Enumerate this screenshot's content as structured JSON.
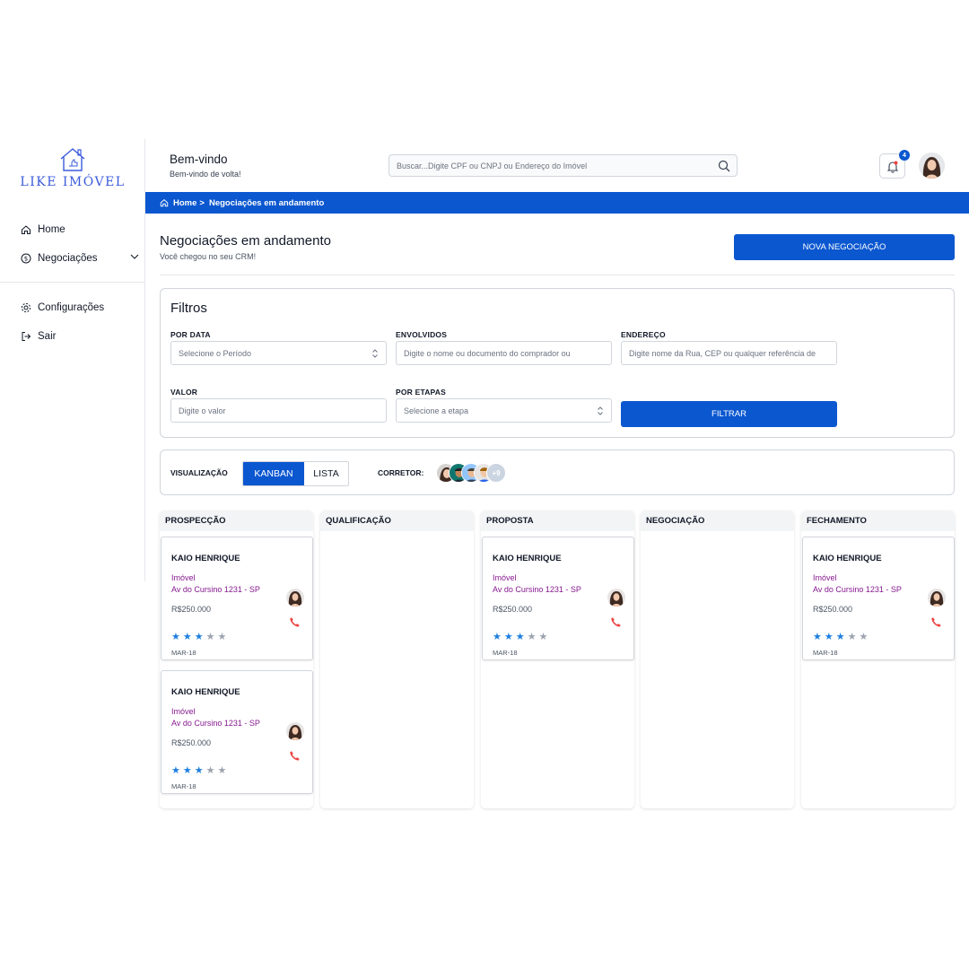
{
  "brand": {
    "logo_text": "LIKE IMÓVEL",
    "color": "#3b5bdb"
  },
  "sidebar": {
    "items": [
      {
        "label": "Home",
        "icon": "home-icon"
      },
      {
        "label": "Negociações",
        "icon": "dollar-circle-icon"
      },
      {
        "label": "Configurações",
        "icon": "gear-icon"
      },
      {
        "label": "Sair",
        "icon": "logout-icon"
      }
    ]
  },
  "header": {
    "title": "Bem-vindo",
    "subtitle": "Bem-vindo de volta!",
    "search_placeholder": "Buscar...Digite CPF ou CNPJ ou Endereço do Imóvel",
    "notifications_count": "4"
  },
  "breadcrumb": {
    "home": "Home",
    "separator": ">",
    "current": "Negociações em andamento"
  },
  "page": {
    "title": "Negociações em andamento",
    "subtitle": "Você chegou no seu CRM!",
    "new_button": "NOVA NEGOCIAÇÃO"
  },
  "filters": {
    "title": "Filtros",
    "date": {
      "label": "POR DATA",
      "placeholder": "Selecione o Período"
    },
    "involved": {
      "label": "ENVOLVIDOS",
      "placeholder": "Digite o nome ou documento do comprador ou"
    },
    "address": {
      "label": "ENDEREÇO",
      "placeholder": "Digite nome da Rua, CEP ou qualquer referência de"
    },
    "value": {
      "label": "VALOR",
      "placeholder": "Digite o valor"
    },
    "stage": {
      "label": "POR ETAPAS",
      "placeholder": "Selecione a etapa"
    },
    "submit": "FILTRAR"
  },
  "view": {
    "label": "VISUALIZAÇÃO",
    "options": [
      "KANBAN",
      "LISTA"
    ],
    "selected": "KANBAN",
    "broker_label": "CORRETOR:",
    "brokers_more": "+9"
  },
  "kanban": {
    "columns": [
      {
        "title": "PROSPECÇÃO"
      },
      {
        "title": "QUALIFICAÇÃO"
      },
      {
        "title": "PROPOSTA"
      },
      {
        "title": "NEGOCIAÇÃO"
      },
      {
        "title": "FECHAMENTO"
      }
    ],
    "cards": [
      {
        "name": "KAIO HENRIQUE",
        "type": "Imóvel",
        "address": "Av do Cursino 1231 - SP",
        "price": "R$250.000",
        "rating": 3,
        "max_rating": 5,
        "date": "MAR-18"
      },
      {
        "name": "KAIO HENRIQUE",
        "type": "Imóvel",
        "address": "Av do Cursino 1231 - SP",
        "price": "R$250.000",
        "rating": 3,
        "max_rating": 5,
        "date": "MAR-18"
      },
      {
        "name": "KAIO HENRIQUE",
        "type": "Imóvel",
        "address": "Av do Cursino 1231 - SP",
        "price": "R$250.000",
        "rating": 3,
        "max_rating": 5,
        "date": "MAR-18"
      },
      {
        "name": "KAIO HENRIQUE",
        "type": "Imóvel",
        "address": "Av do Cursino 1231 - SP",
        "price": "R$250.000",
        "rating": 3,
        "max_rating": 5,
        "date": "MAR-18"
      }
    ]
  },
  "colors": {
    "primary": "#0b57d0",
    "accent_text": "#86198f",
    "phone": "#ef4444",
    "star_on": "#1d7fe0",
    "star_off": "#9ca3af"
  }
}
